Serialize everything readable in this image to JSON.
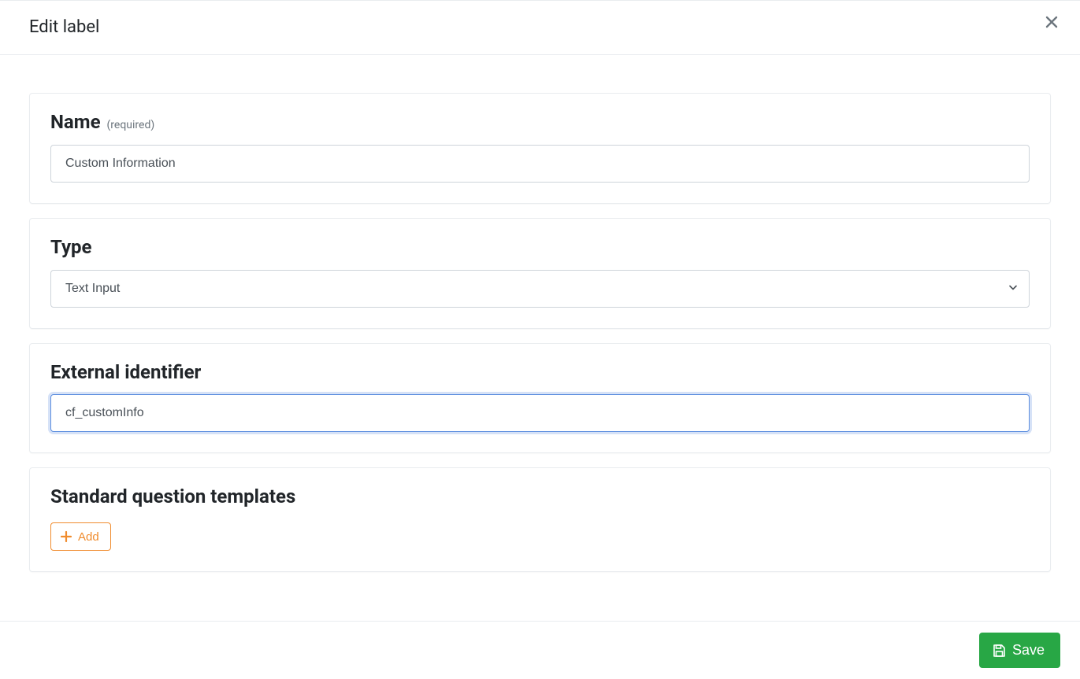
{
  "header": {
    "title": "Edit label"
  },
  "name_section": {
    "label": "Name",
    "required_suffix": "(required)",
    "value": "Custom Information"
  },
  "type_section": {
    "label": "Type",
    "value": "Text Input"
  },
  "external_section": {
    "label": "External identifier",
    "value": "cf_customInfo"
  },
  "templates_section": {
    "label": "Standard question templates",
    "add_label": "Add"
  },
  "footer": {
    "save_label": "Save"
  }
}
